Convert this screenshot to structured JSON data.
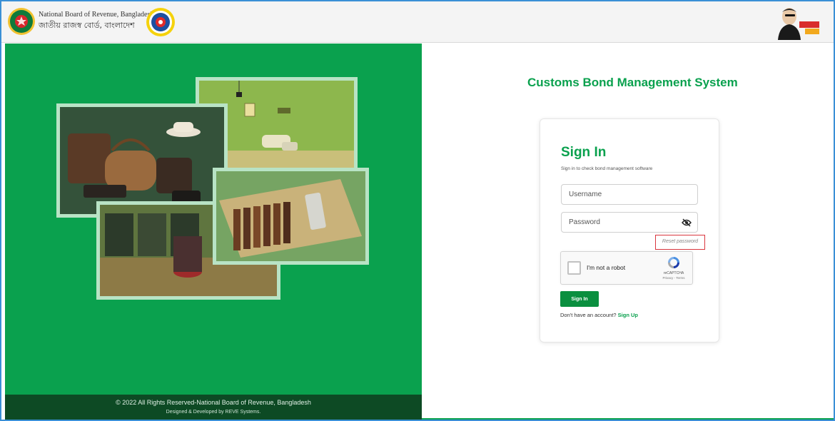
{
  "header": {
    "org_name_en": "National Board of Revenue, Bangladesh",
    "org_name_bn": "জাতীয় রাজস্ব বোর্ড, বাংলাদেশ",
    "nbr_logo_icon": "bangladesh-emblem-icon",
    "customs_logo_icon": "customs-emblem-icon",
    "campaign_logo_icon": "mujib-borsho-logo-icon"
  },
  "left_panel": {
    "background_color": "#0aa14e",
    "collage": [
      {
        "name": "leather-bags-photo"
      },
      {
        "name": "living-room-photo"
      },
      {
        "name": "cigar-box-photo"
      },
      {
        "name": "supermarket-photo"
      }
    ],
    "footer": {
      "copyright": "© 2022 All Rights Reserved-National Board of Revenue, Bangladesh",
      "credits": "Designed & Developed by REVE Systems."
    }
  },
  "main": {
    "system_title": "Customs Bond Management System",
    "signin": {
      "title": "Sign In",
      "subtitle": "Sign in to check bond management software",
      "username_placeholder": "Username",
      "password_placeholder": "Password",
      "password_toggle_icon": "eye-slash-icon",
      "reset_password": "Reset password",
      "recaptcha": {
        "label": "I'm not a robot",
        "brand": "reCAPTCHA",
        "terms": "Privacy - Terms",
        "icon": "recaptcha-icon"
      },
      "submit_label": "Sign In",
      "signup_prompt": "Don't have an account?",
      "signup_link": "Sign Up"
    }
  },
  "colors": {
    "brand_green": "#0aa14e",
    "footer_dark_green": "#0d4a24",
    "highlight_red": "#d9363e"
  }
}
